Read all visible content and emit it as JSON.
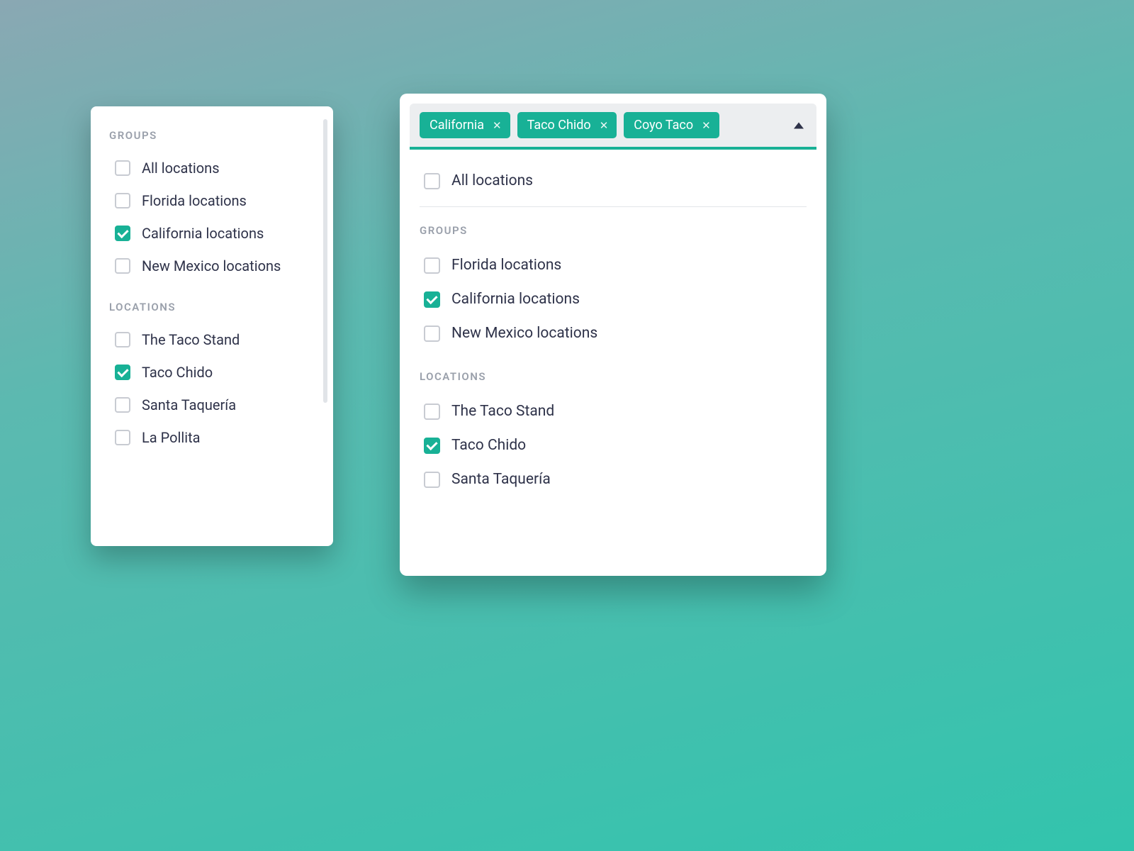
{
  "colors": {
    "accent": "#18b196",
    "text": "#2e3249",
    "muted": "#9aa0ab"
  },
  "panel1": {
    "section1_label": "GROUPS",
    "section2_label": "LOCATIONS",
    "groups": [
      {
        "label": "All locations",
        "checked": false
      },
      {
        "label": "Florida locations",
        "checked": false
      },
      {
        "label": "California locations",
        "checked": true
      },
      {
        "label": "New Mexico locations",
        "checked": false
      }
    ],
    "locations": [
      {
        "label": "The Taco Stand",
        "checked": false
      },
      {
        "label": "Taco Chido",
        "checked": true
      },
      {
        "label": "Santa Taquería",
        "checked": false
      },
      {
        "label": "La Pollita",
        "checked": false
      }
    ]
  },
  "panel2": {
    "chips": [
      {
        "label": "California"
      },
      {
        "label": "Taco Chido"
      },
      {
        "label": "Coyo Taco"
      }
    ],
    "all_label": "All locations",
    "section1_label": "GROUPS",
    "section2_label": "LOCATIONS",
    "groups": [
      {
        "label": "Florida locations",
        "checked": false
      },
      {
        "label": "California locations",
        "checked": true
      },
      {
        "label": "New Mexico locations",
        "checked": false
      }
    ],
    "locations": [
      {
        "label": "The Taco Stand",
        "checked": false
      },
      {
        "label": "Taco Chido",
        "checked": true
      },
      {
        "label": "Santa Taquería",
        "checked": false
      }
    ]
  }
}
